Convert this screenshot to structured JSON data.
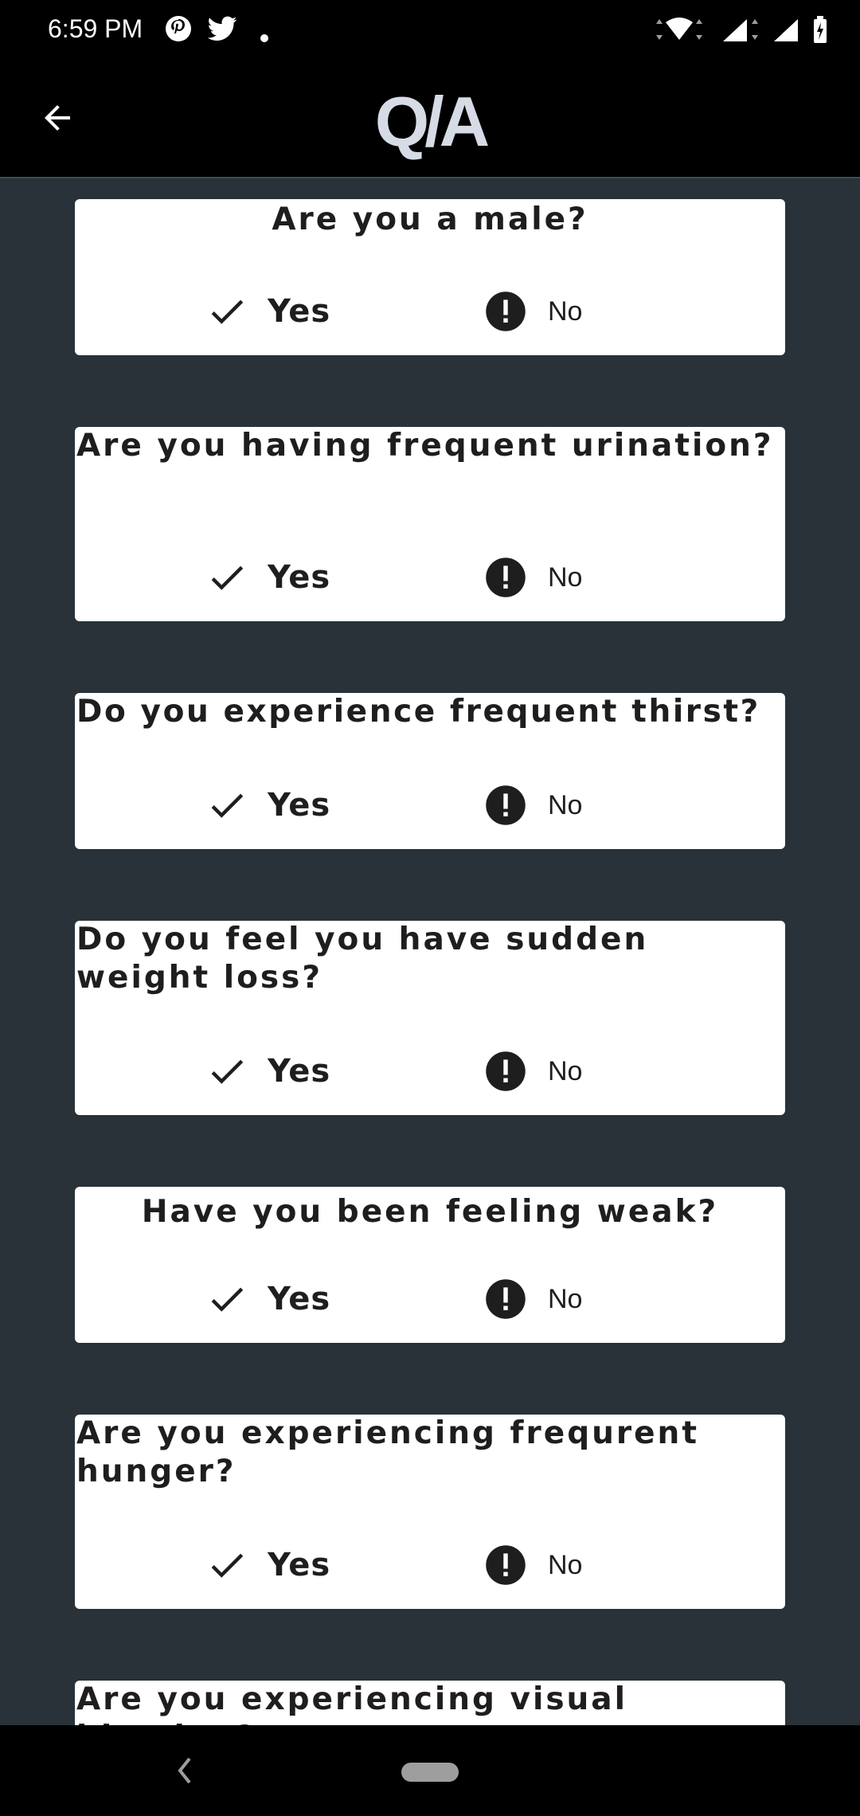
{
  "status_bar": {
    "time": "6:59 PM"
  },
  "app_bar": {
    "title": "Q/A"
  },
  "questions": [
    {
      "text": "Are you a male?",
      "yes": "Yes",
      "no": "No"
    },
    {
      "text": "Are you having frequent urination?",
      "yes": "Yes",
      "no": "No"
    },
    {
      "text": "Do you experience frequent thirst?",
      "yes": "Yes",
      "no": "No"
    },
    {
      "text": "Do you feel you have sudden weight loss?",
      "yes": "Yes",
      "no": "No"
    },
    {
      "text": "Have you been feeling weak?",
      "yes": "Yes",
      "no": "No"
    },
    {
      "text": "Are you experiencing frequrent hunger?",
      "yes": "Yes",
      "no": "No"
    },
    {
      "text": "Are you experiencing visual blurring?"
    }
  ],
  "colors": {
    "background": "#283238",
    "card": "#ffffff",
    "appbar": "#000000",
    "title": "#d7dbe6"
  }
}
